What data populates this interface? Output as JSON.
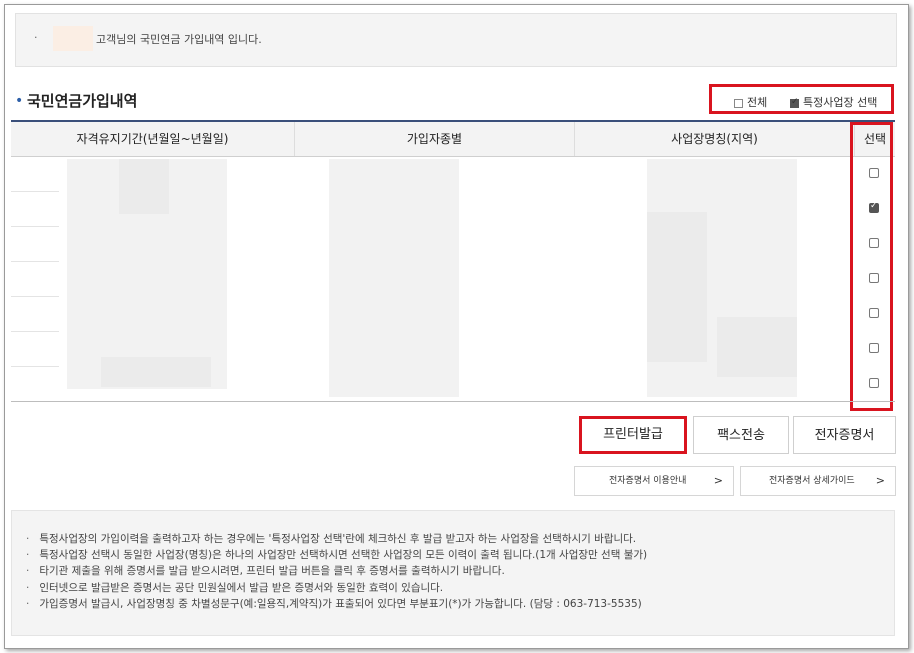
{
  "info_banner": {
    "bullet": "·",
    "message": "고객님의 국민연금 가입내역 입니다."
  },
  "section": {
    "bullet": "•",
    "title": "국민연금가입내역"
  },
  "filters": {
    "all_label": "전체",
    "all_checked": false,
    "specific_label": "특정사업장 선택",
    "specific_checked": true
  },
  "table": {
    "headers": [
      "자격유지기간(년월일~년월일)",
      "가입자종별",
      "사업장명칭(지역)",
      "선택"
    ],
    "row_selected": [
      false,
      true,
      false,
      false,
      false,
      false,
      false
    ]
  },
  "buttons": {
    "print": "프린터발급",
    "fax": "팩스전송",
    "e_cert": "전자증명서"
  },
  "guides": {
    "usage": "전자증명서 이용안내",
    "detail": "전자증명서 상세가이드",
    "arrow": ">"
  },
  "notes": [
    "특정사업장의 가입이력을 출력하고자 하는 경우에는 '특정사업장 선택'란에 체크하신 후 발급 받고자 하는 사업장을 선택하시기 바랍니다.",
    "특정사업장 선택시 동일한 사업장(명칭)은 하나의 사업장만 선택하시면 선택한 사업장의 모든 이력이 출력 됩니다.(1개 사업장만 선택 불가)",
    "타기관 제출을 위해 증명서를 발급 받으시려면, 프린터 발급 버튼을 클릭 후 증명서를 출력하시기 바랍니다.",
    "인터넷으로 발급받은 증명서는 공단 민원실에서 발급 받은 증명서와 동일한 효력이 있습니다.",
    "가입증명서 발급시, 사업장명칭 중 차별성문구(예:일용직,계약직)가 표출되어 있다면 부분표기(*)가 가능합니다. (담당 : 063-713-5535)"
  ],
  "colors": {
    "highlight": "#d9141f",
    "accent": "#2d5fa8",
    "table_border": "#3a4f7a"
  }
}
